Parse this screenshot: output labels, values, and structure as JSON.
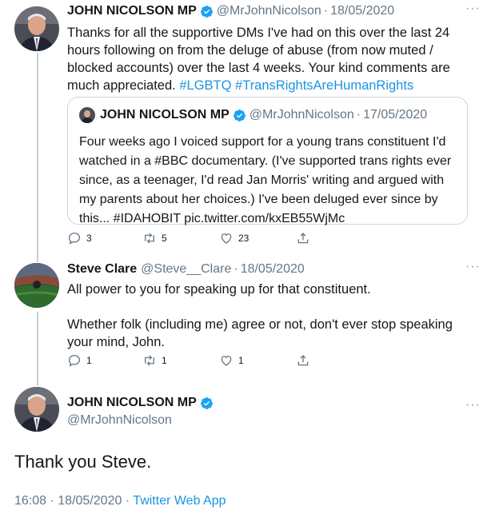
{
  "tweet1": {
    "name": "JOHN NICOLSON MP",
    "handle": "@MrJohnNicolson",
    "sep": "·",
    "date": "18/05/2020",
    "more": "···",
    "text": "Thanks for all the supportive DMs I've had on this over the last 24 hours following on from the deluge of abuse (from now muted / blocked accounts) over the last 4 weeks. Your kind comments are much appreciated.",
    "hashtags": [
      "#LGBTQ",
      "#TransRightsAreHumanRights"
    ],
    "quote": {
      "name": "JOHN NICOLSON MP",
      "handle": "@MrJohnNicolson",
      "sep": "·",
      "date": "17/05/2020",
      "text": "Four weeks ago I voiced support for a young trans constituent I'd watched in a #BBC documentary. (I've supported trans rights ever since, as a teenager, I'd read Jan Morris' writing and argued with my parents about her choices.) I've been deluged ever since by this... #IDAHOBIT pic.twitter.com/kxEB55WjMc"
    },
    "reply_count": "3",
    "retweet_count": "5",
    "like_count": "23"
  },
  "tweet2": {
    "name": "Steve Clare",
    "handle": "@Steve__Clare",
    "sep": "·",
    "date": "18/05/2020",
    "more": "···",
    "line1": "All power to you for speaking up for that constituent.",
    "line2": "Whether folk (including me) agree or not, don't ever stop speaking your mind, John.",
    "reply_count": "1",
    "retweet_count": "1",
    "like_count": "1"
  },
  "main": {
    "name": "JOHN NICOLSON MP",
    "handle": "@MrJohnNicolson",
    "more": "···",
    "text": "Thank you Steve.",
    "time": "16:08",
    "sep": "·",
    "date": "18/05/2020",
    "source": "Twitter Web App"
  },
  "colors": {
    "link": "#1b95e0",
    "verified": "#1da1f2",
    "muted": "#657786"
  },
  "icons": [
    "verified-badge-icon",
    "reply-icon",
    "retweet-icon",
    "like-icon",
    "share-icon",
    "more-icon"
  ]
}
